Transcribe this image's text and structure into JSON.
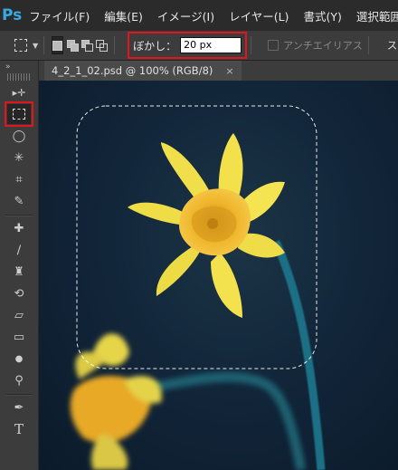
{
  "app": {
    "logo": "Ps"
  },
  "menubar": {
    "items": [
      "ファイル(F)",
      "編集(E)",
      "イメージ(I)",
      "レイヤー(L)",
      "書式(Y)",
      "選択範囲"
    ]
  },
  "options": {
    "feather_label": "ぼかし：",
    "feather_value": "20 px",
    "antialias_label": "アンチエイリアス",
    "style_label": "スタイ"
  },
  "toolbar": {
    "collapse_glyph": "»",
    "tools": [
      {
        "name": "move-tool-icon",
        "glyph": "▸✛"
      },
      {
        "name": "rect-marquee-tool-icon",
        "glyph": ""
      },
      {
        "name": "lasso-tool-icon",
        "glyph": "◯"
      },
      {
        "name": "magic-wand-tool-icon",
        "glyph": "✳"
      },
      {
        "name": "crop-tool-icon",
        "glyph": "⌗"
      },
      {
        "name": "eyedropper-tool-icon",
        "glyph": "✎"
      },
      {
        "name": "healing-brush-tool-icon",
        "glyph": "✚"
      },
      {
        "name": "brush-tool-icon",
        "glyph": "∕"
      },
      {
        "name": "clone-stamp-tool-icon",
        "glyph": "♜"
      },
      {
        "name": "history-brush-tool-icon",
        "glyph": "⟲"
      },
      {
        "name": "eraser-tool-icon",
        "glyph": "▱"
      },
      {
        "name": "gradient-tool-icon",
        "glyph": "▭"
      },
      {
        "name": "blur-tool-icon",
        "glyph": "●"
      },
      {
        "name": "dodge-tool-icon",
        "glyph": "⚲"
      },
      {
        "name": "pen-tool-icon",
        "glyph": "✒"
      },
      {
        "name": "type-tool-icon",
        "glyph": "T"
      }
    ]
  },
  "document": {
    "tab_title": "4_2_1_02.psd @ 100% (RGB/8)",
    "close_glyph": "×"
  },
  "colors": {
    "accent_red": "#e0161c",
    "ps_blue": "#39a9e0",
    "petal_yellow": "#f2e14a",
    "trumpet_orange": "#efb52b",
    "stem_teal": "#1e6f86"
  }
}
